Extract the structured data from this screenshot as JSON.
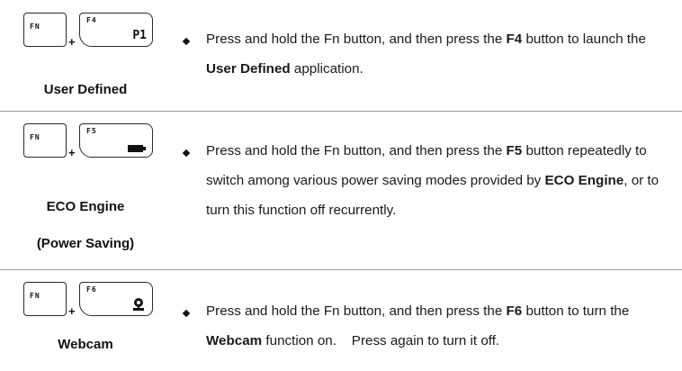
{
  "rows": [
    {
      "fn_key": "FN",
      "f_key": "F4",
      "f_key_sub": "P1",
      "label_line1": "User Defined",
      "desc": {
        "t1": "Press and hold the Fn button, and then press the ",
        "b1": "F4",
        "t2": " button to launch the ",
        "b2": "User Defined",
        "t3": " application."
      }
    },
    {
      "fn_key": "FN",
      "f_key": "F5",
      "f_key_icon": "battery-icon",
      "label_line1": "ECO Engine",
      "label_line2": "(Power Saving)",
      "desc": {
        "t1": "Press and hold the Fn button, and then press the ",
        "b1": "F5",
        "t2": " button repeatedly to switch among various power saving modes provided by ",
        "b2": "ECO Engine",
        "t3": ", or to turn this function off recurrently."
      }
    },
    {
      "fn_key": "FN",
      "f_key": "F6",
      "f_key_icon": "webcam-icon",
      "label_line1": "Webcam",
      "desc": {
        "t1": "Press and hold the Fn button, and then press the ",
        "b1": "F6",
        "t2": " button to turn the ",
        "b2": "Webcam",
        "t3": " function on.    Press again to turn it off."
      }
    }
  ],
  "plus_sign": "+"
}
